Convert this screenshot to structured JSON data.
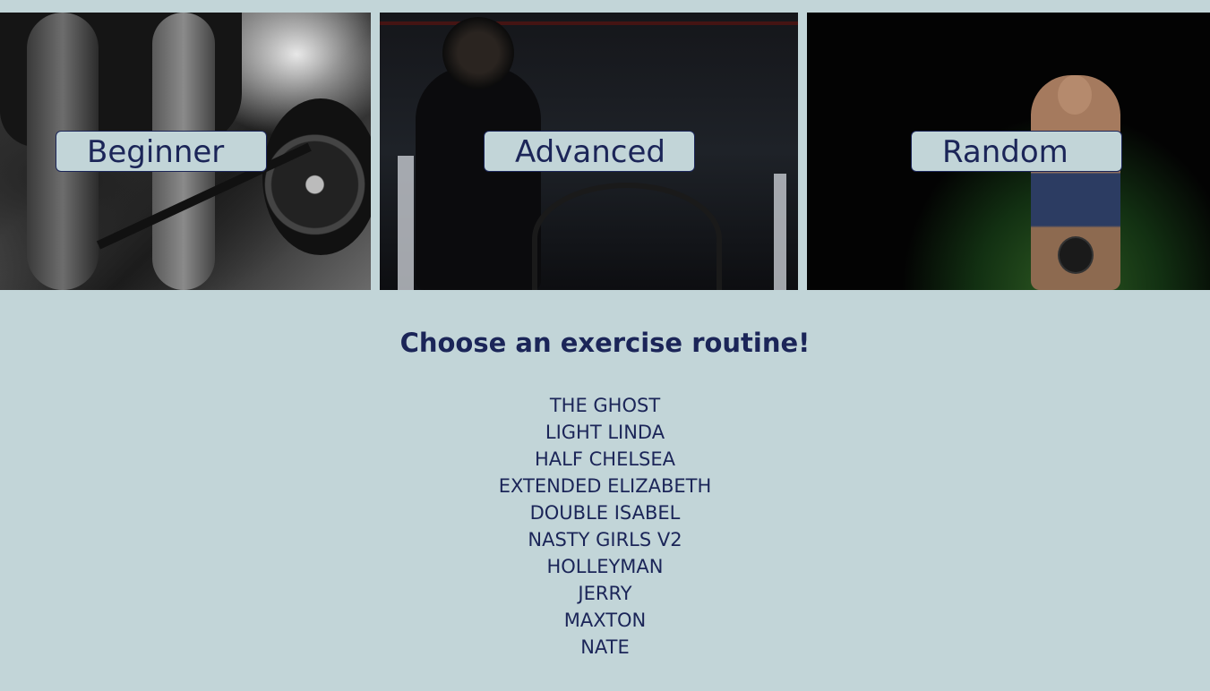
{
  "tiers": [
    {
      "label": "Beginner"
    },
    {
      "label": "Advanced"
    },
    {
      "label": "Random"
    }
  ],
  "heading": "Choose an exercise routine!",
  "routines": [
    "THE GHOST",
    "LIGHT LINDA",
    "HALF CHELSEA",
    "EXTENDED ELIZABETH",
    "DOUBLE ISABEL",
    "NASTY GIRLS V2",
    "HOLLEYMAN",
    "JERRY",
    "MAXTON",
    "NATE"
  ],
  "colors": {
    "background": "#c2d5d8",
    "text": "#1b2558"
  }
}
